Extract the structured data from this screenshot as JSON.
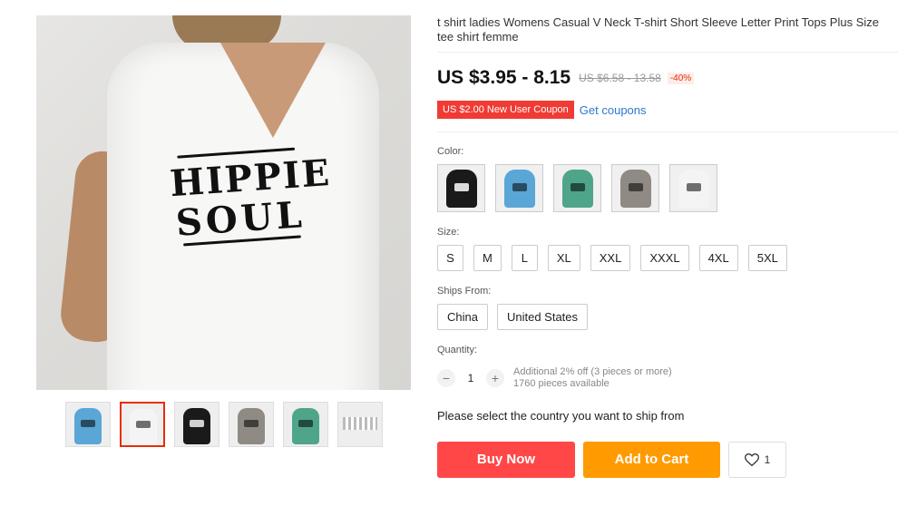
{
  "product": {
    "title": "t shirt ladies Womens Casual V Neck T-shirt Short Sleeve Letter Print Tops Plus Size tee shirt femme",
    "price": "US $3.95 - 8.15",
    "old_price": "US $6.58 - 13.58",
    "discount": "-40%",
    "coupon": "US $2.00 New User Coupon",
    "get_coupons": "Get coupons",
    "print_text": [
      "HIPPIE",
      "SOUL"
    ]
  },
  "gallery": {
    "thumbnails": [
      {
        "color": "#5aa6d6",
        "dark": false
      },
      {
        "color": "#f4f4f4",
        "dark": false
      },
      {
        "color": "#1a1a1a",
        "dark": true
      },
      {
        "color": "#8f8a84",
        "dark": false
      },
      {
        "color": "#4fa58a",
        "dark": false
      },
      {
        "stripes": true
      }
    ],
    "active_index": 1
  },
  "options": {
    "color_label": "Color:",
    "colors": [
      {
        "swatch": "#1a1a1a",
        "dark": true
      },
      {
        "swatch": "#5aa6d6",
        "dark": false
      },
      {
        "swatch": "#4fa58a",
        "dark": false
      },
      {
        "swatch": "#8f8a84",
        "dark": false
      },
      {
        "swatch": "#f4f4f4",
        "dark": false
      }
    ],
    "size_label": "Size:",
    "sizes": [
      "S",
      "M",
      "L",
      "XL",
      "XXL",
      "XXXL",
      "4XL",
      "5XL"
    ],
    "ships_label": "Ships From:",
    "ships_from": [
      "China",
      "United States"
    ],
    "quantity_label": "Quantity:",
    "quantity": "1",
    "qty_minus": "−",
    "qty_plus": "+",
    "qty_discount": "Additional 2% off (3 pieces or more)",
    "qty_available": "1760 pieces available"
  },
  "ship_message": "Please select the country you want to ship from",
  "actions": {
    "buy_now": "Buy Now",
    "add_to_cart": "Add to Cart",
    "wishlist_count": "1"
  },
  "colors": {
    "accent_red": "#ff4747",
    "accent_orange": "#ff9a00",
    "coupon_red": "#f03b35",
    "link_blue": "#2e77d0"
  }
}
